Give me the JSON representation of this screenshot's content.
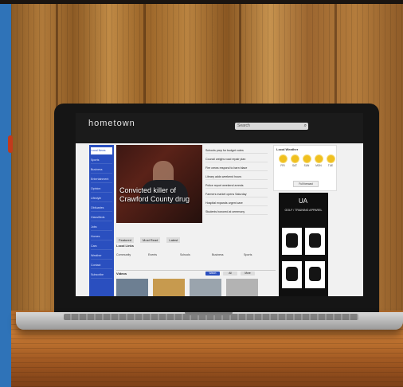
{
  "site": {
    "logo": "hometown",
    "search_placeholder": "Search"
  },
  "sidebar": {
    "items": [
      "Local News",
      "Sports",
      "Business",
      "Entertainment",
      "Opinion",
      "Lifestyle",
      "Obituaries",
      "Classifieds",
      "Jobs",
      "Homes",
      "Cars",
      "Weather",
      "Contact",
      "Subscribe"
    ]
  },
  "hero": {
    "headline": "Convicted killer of Crawford County drug"
  },
  "headlines": [
    "Schools prep for budget votes",
    "Council weighs road repair plan",
    "Fire crews respond to barn blaze",
    "Library adds weekend hours",
    "Police report weekend arrests",
    "Farmers market opens Saturday",
    "Hospital expands urgent care",
    "Students honored at ceremony"
  ],
  "weather": {
    "title": "Local Weather",
    "days": [
      "FRI",
      "SAT",
      "SUN",
      "MON",
      "TUE"
    ],
    "more_label": "Full forecast"
  },
  "ad": {
    "brand": "UA",
    "text": "GOLF / TRAINING APPAREL"
  },
  "section": {
    "tabs": [
      "Featured",
      "Most Read",
      "Latest"
    ],
    "label": "Local Links",
    "categories": [
      "Community",
      "Events",
      "Schools",
      "Business",
      "Sports"
    ],
    "video_label": "Videos",
    "buttons": [
      "Watch",
      "All",
      "More"
    ]
  },
  "colors": {
    "nav_blue": "#2a4fbf",
    "header_dark": "#1b1b1b",
    "sun": "#f0c020"
  }
}
